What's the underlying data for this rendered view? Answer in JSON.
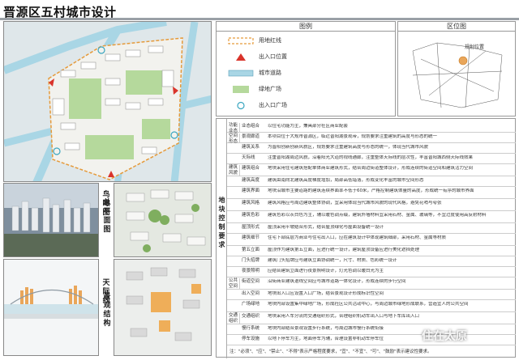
{
  "title": "晋源区五村城市设计",
  "labels": {
    "aerial": "鸟瞰图",
    "skyline": "天际线",
    "plan2": "总平面图",
    "render": "景观结构"
  },
  "legend": {
    "header": "图例",
    "items": [
      {
        "label": "用地红线",
        "icon": "dashed-boundary"
      },
      {
        "label": "出入口位置",
        "icon": "red-triangle"
      },
      {
        "label": "城市道路",
        "icon": "road"
      },
      {
        "label": "绿地广场",
        "icon": "green-square"
      },
      {
        "label": "出入口广场",
        "icon": "circle"
      }
    ]
  },
  "location": {
    "header": "区位图",
    "tag": "规划位置"
  },
  "requirements": {
    "big_category": "地块控制要求",
    "rows": [
      {
        "cat": "功能业态",
        "sub": "业态组合",
        "text": "以住宅功能为主，兼具部分社区商业配套"
      },
      {
        "cat": "空间形态",
        "sub": "景观廊道",
        "text": "本项目位于大规市晋源区，临近晋阳湖景观带，规划要求注重建筑的高度与形态的统一"
      },
      {
        "cat": "",
        "sub": "建筑关系",
        "text": "为晋阳创新创新风貌区，规划要求注重建筑高度与形态的统一，体现当代城市风貌"
      },
      {
        "cat": "",
        "sub": "天际线",
        "text": "注重晋阳湖周边风貌，沿着阳光大道的视线通廊，注重整体天际线的层次性，丰富晋阳城西侧天际线效果"
      },
      {
        "cat": "建筑风貌",
        "sub": "建筑组合",
        "text": "地块采用住宅建筑搭配单体商业建筑形式，结合周边街道整体设计，形成连续的街道空间和建筑活力空间"
      },
      {
        "cat": "",
        "sub": "建筑高度",
        "text": "建筑由南向北建筑高度梯度增加，局部高低错落，形成变化丰富的城市空间形态"
      },
      {
        "cat": "",
        "sub": "建筑界面",
        "text": "地块沿城市主要道路的建筑连续界面率不低于60米，严格控制建筑体量的高度，形成统一有序的城市界面"
      },
      {
        "cat": "",
        "sub": "建筑风格",
        "text": "建筑风格应与周边建筑整体协调，宜采用体现当代城市风貌的现代风格，避免花哨与夸张"
      },
      {
        "cat": "",
        "sub": "建筑色彩",
        "text": "建筑色彩以灰白色为主，辅以暖色调点缀，建筑外墙材料宜采用石材、金属、玻璃等，不宜过度使用高反射材料"
      },
      {
        "cat": "",
        "sub": "屋顶形式",
        "text": "屋顶采用平坡结合形式，结合屋顶绿化与屋面设备统一设计"
      },
      {
        "cat": "",
        "sub": "建筑细节",
        "text": "住宅下部底层为商业与住宅出入口，应在建筑设计中体现建筑细部，采用石材、金属等材质"
      },
      {
        "cat": "",
        "sub": "第五立面",
        "text": "屋顶作为建筑第五立面，应进行统一设计，建筑屋顶设备应进行美化遮挡处理"
      },
      {
        "cat": "",
        "sub": "门头招牌",
        "text": "建筑门头招牌应与建筑立面协调统一，尺寸、材质、色彩统一设计"
      },
      {
        "cat": "",
        "sub": "夜景照明",
        "text": "应结合建筑立面进行夜景照明设计，灯光色调以暖白光为主"
      },
      {
        "cat": "公共空间",
        "sub": "街道空间",
        "text": "沿街商业建筑退线空间应与城市道路一体化设计，形成连续的步行空间"
      },
      {
        "cat": "",
        "sub": "出入空间",
        "text": "地块出入口应设置入口广场，结合景观设计形成标识性空间"
      },
      {
        "cat": "",
        "sub": "广场绿地",
        "text": "地块内部设置集中绿地广场，形成社区公共活动中心，与周边城市绿地形成联系，营造宜人的公共空间"
      },
      {
        "cat": "交通组织",
        "sub": "交通组织",
        "text": "地块采用人车分流的交通组织形式，合理组织机动车出入口与地下车库出入口"
      },
      {
        "cat": "",
        "sub": "慢行系统",
        "text": "地块内部结合景观设置步行系统，与周边城市慢行系统衔接"
      },
      {
        "cat": "",
        "sub": "停车设施",
        "text": "以地下停车为主，地面停车为辅，合理设置非机动车停车位"
      }
    ],
    "footnote": "注：\"必须\"、\"应\"、\"禁止\"、\"不得\"表示严格程度要求，\"宜\"、\"不宜\"、\"可\"、\"鼓励\"表示建议性要求。"
  },
  "watermark": "住在太原"
}
